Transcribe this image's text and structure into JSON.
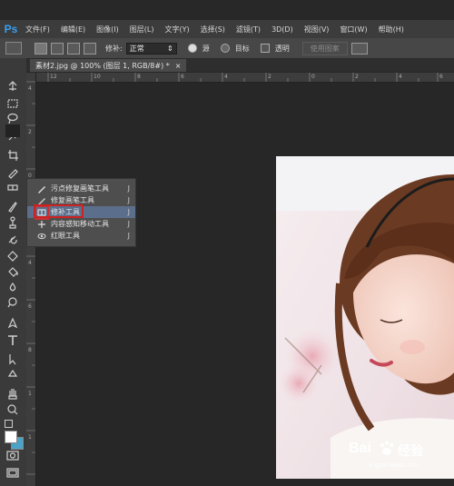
{
  "app": {
    "logo": "Ps"
  },
  "menu": [
    "文件(F)",
    "编辑(E)",
    "图像(I)",
    "图层(L)",
    "文字(Y)",
    "选择(S)",
    "滤镜(T)",
    "3D(D)",
    "视图(V)",
    "窗口(W)",
    "帮助(H)"
  ],
  "options": {
    "patch_label": "修补:",
    "patch_value": "正常",
    "source_label": "源",
    "dest_label": "目标",
    "transparent_label": "透明",
    "use_pattern_label": "使用图案"
  },
  "document_tab": {
    "title": "素材2.jpg @ 100% (图层 1, RGB/8#) *",
    "close": "×"
  },
  "ruler": {
    "h_ticks": [
      "12",
      "10",
      "8",
      "6",
      "4",
      "2",
      "0",
      "2",
      "4",
      "6"
    ],
    "v_ticks": [
      "4",
      "2",
      "0",
      "2",
      "4",
      "6",
      "8",
      "1",
      "1"
    ]
  },
  "flyout": {
    "items": [
      {
        "label": "污点修复画笔工具",
        "shortcut": "J",
        "icon": "spot-healing-brush-icon"
      },
      {
        "label": "修复画笔工具",
        "shortcut": "J",
        "icon": "healing-brush-icon"
      },
      {
        "label": "修补工具",
        "shortcut": "J",
        "icon": "patch-tool-icon",
        "selected": true
      },
      {
        "label": "内容感知移动工具",
        "shortcut": "J",
        "icon": "content-aware-move-icon"
      },
      {
        "label": "红眼工具",
        "shortcut": "J",
        "icon": "red-eye-icon"
      }
    ]
  },
  "watermark": {
    "brand": "Bai",
    "brand2": "经验",
    "url": "jingyan.baidu.com"
  },
  "colors": {
    "accent": "#39a0f2",
    "highlight": "#5b6f8c",
    "red_box": "#cc2222"
  }
}
